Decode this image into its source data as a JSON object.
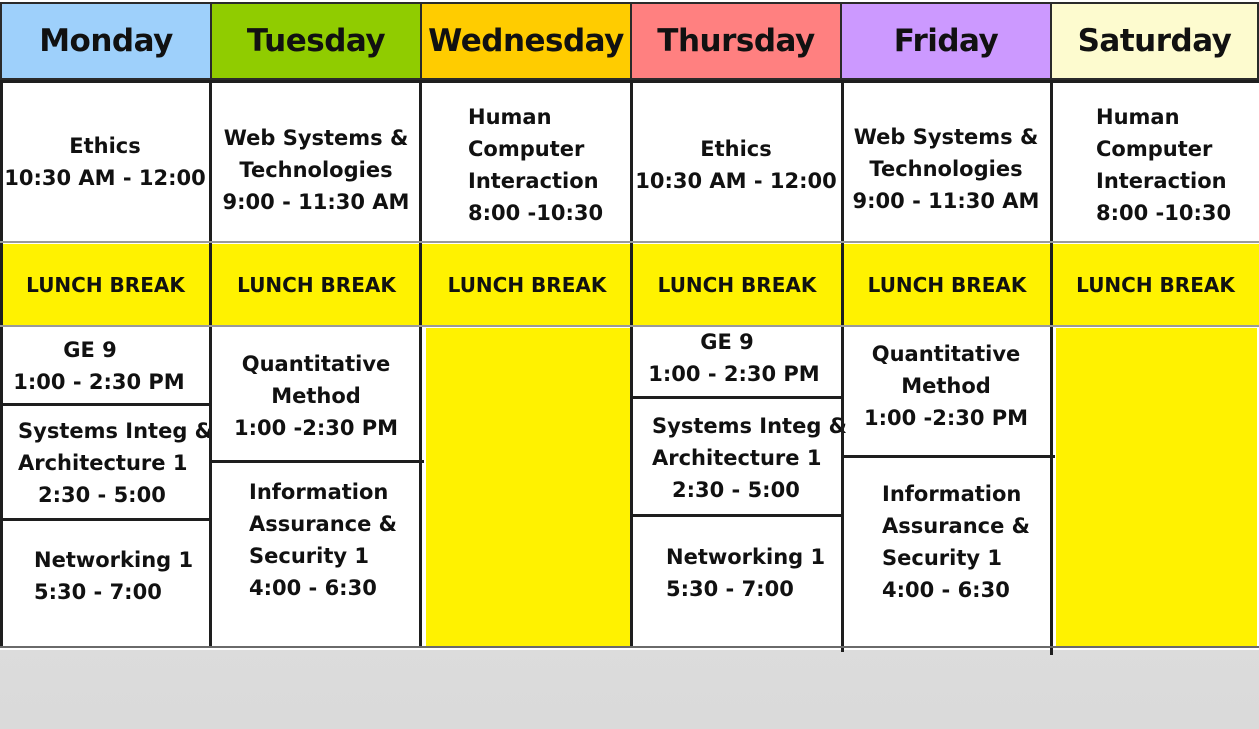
{
  "days": [
    "Monday",
    "Tuesday",
    "Wednesday",
    "Thursday",
    "Friday",
    "Saturday"
  ],
  "colors": {
    "monday": "#9ed0fb",
    "tuesday": "#90cc00",
    "wednesday": "#ffcc00",
    "thursday": "#ff8080",
    "friday": "#cc99ff",
    "saturday": "#fdfbcf",
    "lunch": "#fff200",
    "free": "#fff200"
  },
  "lunch_label": "LUNCH BREAK",
  "morning": {
    "monday": {
      "lines": [
        "Ethics",
        "10:30 AM - 12:00"
      ]
    },
    "tuesday": {
      "lines": [
        "Web Systems &",
        "Technologies",
        "9:00 - 11:30 AM"
      ]
    },
    "wednesday": {
      "lines": [
        "Human",
        "Computer",
        "Interaction",
        "8:00 -10:30"
      ]
    },
    "thursday": {
      "lines": [
        "Ethics",
        "10:30 AM - 12:00"
      ]
    },
    "friday": {
      "lines": [
        "Web Systems &",
        "Technologies",
        "9:00 - 11:30 AM"
      ]
    },
    "saturday": {
      "lines": [
        "Human",
        "Computer",
        "Interaction",
        "8:00 -10:30"
      ]
    }
  },
  "afternoon": {
    "monday": [
      {
        "lines": [
          "GE 9",
          "1:00 - 2:30 PM"
        ]
      },
      {
        "lines": [
          "Systems Integ &",
          "Architecture 1",
          "2:30 - 5:00"
        ]
      },
      {
        "lines": [
          "Networking 1",
          "5:30 - 7:00"
        ]
      }
    ],
    "tuesday": [
      {
        "lines": [
          "Quantitative",
          "Method",
          "1:00 -2:30 PM"
        ]
      },
      {
        "lines": [
          "Information",
          "Assurance &",
          "Security 1",
          "4:00 - 6:30"
        ]
      }
    ],
    "thursday": [
      {
        "lines": [
          "GE 9",
          "1:00 - 2:30 PM"
        ]
      },
      {
        "lines": [
          "Systems Integ &",
          "Architecture 1",
          "2:30 - 5:00"
        ]
      },
      {
        "lines": [
          "Networking 1",
          "5:30 - 7:00"
        ]
      }
    ],
    "friday": [
      {
        "lines": [
          "Quantitative",
          "Method",
          "1:00 -2:30 PM"
        ]
      },
      {
        "lines": [
          "Information",
          "Assurance &",
          "Security 1",
          "4:00 - 6:30"
        ]
      }
    ]
  }
}
